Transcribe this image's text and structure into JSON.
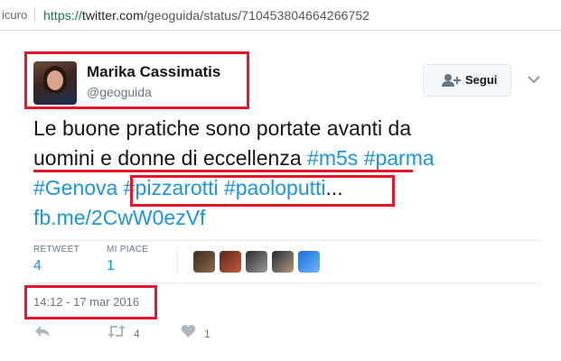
{
  "browser": {
    "secure_label": "icuro",
    "url_protocol": "https://",
    "url_host": "twitter.com",
    "url_path": "/geoguida/status/710453804664266752"
  },
  "tweet": {
    "author_name": "Marika Cassimatis",
    "author_handle": "@geoguida",
    "follow_label": "Segui",
    "text_plain_1": "Le buone pratiche sono portate avanti da",
    "text_plain_2": "uomini e donne di eccellenza ",
    "hashtag_m5s": "#m5s",
    "hashtag_parma": "#parma",
    "hashtag_genova": "#Genova",
    "hashtag_pizzarotti": "#pizzarotti",
    "hashtag_paoloputti": "#paoloputti",
    "ellipsis": "...",
    "link": "fb.me/2CwW0ezVf",
    "retweet_label": "RETWEET",
    "retweet_count": "4",
    "likes_label": "MI PIACE",
    "likes_count": "1",
    "timestamp": "14:12 - 17 mar 2016",
    "action_retweet_count": "4",
    "action_like_count": "1"
  },
  "icons": [
    "lock-icon",
    "follow-user-icon",
    "chevron-down-icon",
    "reply-icon",
    "retweet-icon",
    "heart-icon"
  ],
  "colors": {
    "link": "#1b95e0",
    "highlight": "#e8162b",
    "muted": "#657786"
  }
}
